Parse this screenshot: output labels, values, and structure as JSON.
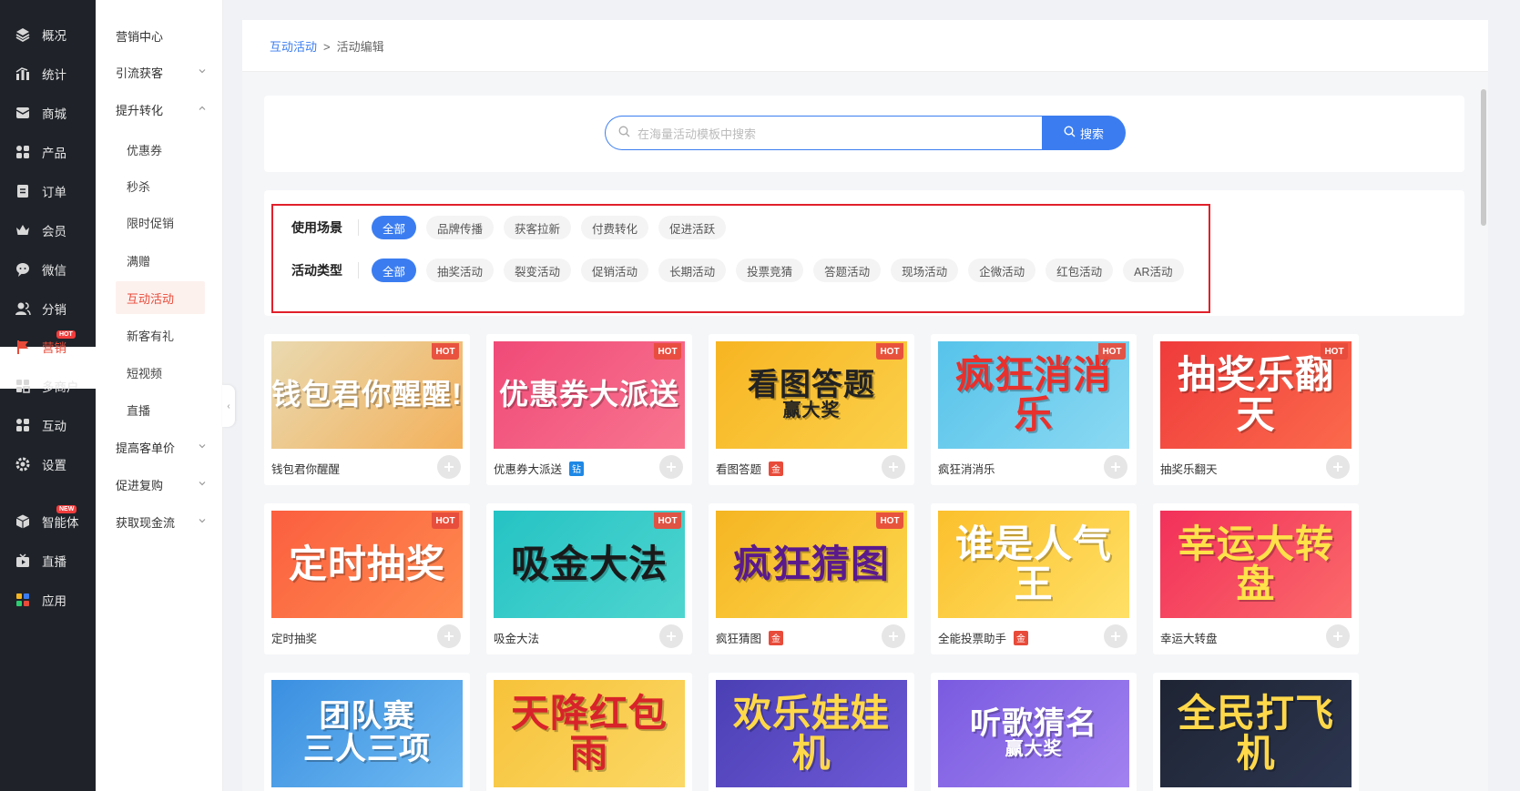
{
  "nav_primary": [
    {
      "label": "概况",
      "icon": "layers-icon"
    },
    {
      "label": "统计",
      "icon": "bar-chart-icon"
    },
    {
      "label": "商城",
      "icon": "mail-icon"
    },
    {
      "label": "产品",
      "icon": "grid-icon"
    },
    {
      "label": "订单",
      "icon": "clipboard-icon"
    },
    {
      "label": "会员",
      "icon": "crown-icon"
    },
    {
      "label": "微信",
      "icon": "chat-bubble-icon"
    },
    {
      "label": "分销",
      "icon": "users-icon"
    },
    {
      "label": "营销",
      "icon": "flag-icon",
      "badge": "HOT"
    },
    {
      "label": "多商户",
      "icon": "shop-icon"
    },
    {
      "label": "互动",
      "icon": "grid-icon"
    },
    {
      "label": "设置",
      "icon": "gear-icon"
    },
    {
      "label": "智能体",
      "icon": "cube-icon",
      "badge": "NEW"
    },
    {
      "label": "直播",
      "icon": "video-icon"
    },
    {
      "label": "应用",
      "icon": "apps-icon"
    }
  ],
  "nav_secondary": [
    {
      "label": "营销中心",
      "type": "group"
    },
    {
      "label": "引流获客",
      "type": "group",
      "chevron": "down"
    },
    {
      "label": "提升转化",
      "type": "group",
      "chevron": "up"
    },
    {
      "label": "优惠券",
      "type": "sub"
    },
    {
      "label": "秒杀",
      "type": "sub"
    },
    {
      "label": "限时促销",
      "type": "sub"
    },
    {
      "label": "满赠",
      "type": "sub"
    },
    {
      "label": "互动活动",
      "type": "sub",
      "active": true
    },
    {
      "label": "新客有礼",
      "type": "sub"
    },
    {
      "label": "短视频",
      "type": "sub"
    },
    {
      "label": "直播",
      "type": "sub"
    },
    {
      "label": "提高客单价",
      "type": "group",
      "chevron": "down"
    },
    {
      "label": "促进复购",
      "type": "group",
      "chevron": "down"
    },
    {
      "label": "获取现金流",
      "type": "group",
      "chevron": "down"
    }
  ],
  "breadcrumb": {
    "parent": "互动活动",
    "sep": ">",
    "current": "活动编辑"
  },
  "search": {
    "placeholder": "在海量活动模板中搜索",
    "button": "搜索"
  },
  "filters": {
    "scene": {
      "label": "使用场景",
      "options": [
        "全部",
        "品牌传播",
        "获客拉新",
        "付费转化",
        "促进活跃"
      ],
      "selected": "全部"
    },
    "type": {
      "label": "活动类型",
      "options": [
        "全部",
        "抽奖活动",
        "裂变活动",
        "促销活动",
        "长期活动",
        "投票竞猜",
        "答题活动",
        "现场活动",
        "企微活动",
        "红包活动",
        "AR活动"
      ],
      "selected": "全部"
    }
  },
  "hot_label": "HOT",
  "cards": [
    {
      "name": "钱包君你醒醒",
      "thumb_text": "钱包君你醒醒!",
      "hot": true,
      "tag": "",
      "bg1": "#e9d9b0",
      "bg2": "#f3b15b",
      "fg": "#ffffff"
    },
    {
      "name": "优惠券大派送",
      "thumb_text": "优惠券大派送",
      "hot": true,
      "tag": "钻",
      "bg1": "#f04a78",
      "bg2": "#f8758f",
      "fg": "#ffffff"
    },
    {
      "name": "看图答题",
      "thumb_text": "看图答题 赢大奖",
      "hot": true,
      "tag": "金",
      "bg1": "#f7b522",
      "bg2": "#fbd04a",
      "fg": "#222222"
    },
    {
      "name": "疯狂消消乐",
      "thumb_text": "疯狂消消乐",
      "hot": true,
      "tag": "",
      "bg1": "#57c3ea",
      "bg2": "#8bd9f2",
      "fg": "#e8302c"
    },
    {
      "name": "抽奖乐翻天",
      "thumb_text": "抽奖乐翻天",
      "hot": true,
      "tag": "",
      "bg1": "#ef3b3b",
      "bg2": "#fb6a4c",
      "fg": "#ffffff"
    },
    {
      "name": "定时抽奖",
      "thumb_text": "定时抽奖",
      "hot": true,
      "tag": "",
      "bg1": "#fb5f3f",
      "bg2": "#ff8b4f",
      "fg": "#ffffff"
    },
    {
      "name": "吸金大法",
      "thumb_text": "吸金大法",
      "hot": true,
      "tag": "",
      "bg1": "#25c3c4",
      "bg2": "#4fd5cf",
      "fg": "#1a1a1a"
    },
    {
      "name": "疯狂猜图",
      "thumb_text": "疯狂猜图",
      "hot": true,
      "tag": "金",
      "bg1": "#f5b522",
      "bg2": "#fcd74d",
      "fg": "#5a1a8c"
    },
    {
      "name": "全能投票助手",
      "thumb_text": "谁是人气王",
      "hot": false,
      "tag": "金",
      "bg1": "#fbc02d",
      "bg2": "#ffe066",
      "fg": "#ffffff"
    },
    {
      "name": "幸运大转盘",
      "thumb_text": "幸运大转盘",
      "hot": false,
      "tag": "",
      "bg1": "#f2305a",
      "bg2": "#fb6a6a",
      "fg": "#ffe14a"
    },
    {
      "name": "团队赛 三人三项",
      "thumb_text": "团队赛 三人三项",
      "hot": false,
      "tag": "",
      "bg1": "#3a8fe0",
      "bg2": "#6fbaf2",
      "fg": "#ffffff"
    },
    {
      "name": "天降红包雨",
      "thumb_text": "天降红包雨",
      "hot": false,
      "tag": "",
      "bg1": "#f7c23a",
      "bg2": "#fbd865",
      "fg": "#d8232a"
    },
    {
      "name": "欢乐娃娃机",
      "thumb_text": "欢乐娃娃机",
      "hot": false,
      "tag": "",
      "bg1": "#4b3fb4",
      "bg2": "#6d59d6",
      "fg": "#ffd84a"
    },
    {
      "name": "听歌猜名赢大奖",
      "thumb_text": "听歌猜名 赢大奖",
      "hot": false,
      "tag": "",
      "bg1": "#7a5be0",
      "bg2": "#a282f0",
      "fg": "#ffffff"
    },
    {
      "name": "全民打飞机",
      "thumb_text": "全民打飞机",
      "hot": false,
      "tag": "",
      "bg1": "#1e2433",
      "bg2": "#2c3650",
      "fg": "#ffd84a"
    }
  ]
}
